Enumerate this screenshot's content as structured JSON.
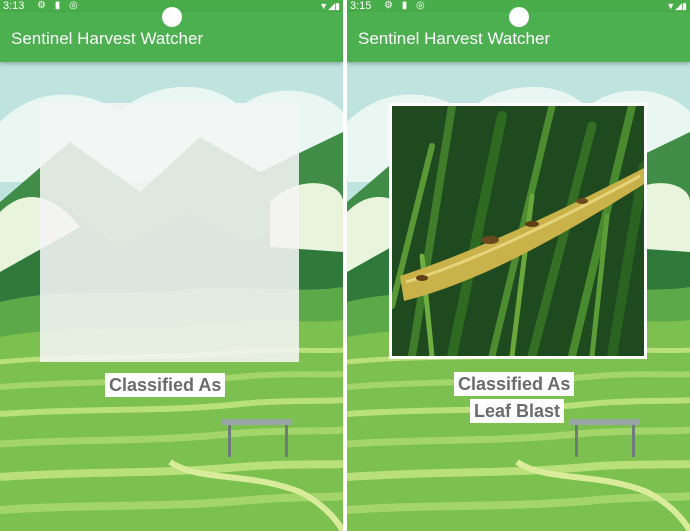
{
  "screens": [
    {
      "status": {
        "time": "3:13",
        "left_icons": "⚙ ▮ ◎",
        "right_icons": "▼◢▮"
      },
      "app_title": "Sentinel Harvest Watcher",
      "image_state": "placeholder",
      "result": {
        "line1": "Classified As",
        "line2": ""
      }
    },
    {
      "status": {
        "time": "3:15",
        "left_icons": "⚙ ▮ ◎",
        "right_icons": "▼◢▮"
      },
      "app_title": "Sentinel Harvest Watcher",
      "image_state": "rice-leaf-photo",
      "result": {
        "line1": "Classified As",
        "line2": "Leaf Blast"
      }
    }
  ],
  "colors": {
    "appbar": "#4caf50",
    "statusbar": "#49ad49",
    "label_text": "#6b6b6b"
  },
  "icons": [
    "settings-icon",
    "sim-card-icon",
    "data-saver-icon",
    "wifi-icon",
    "signal-icon",
    "battery-icon"
  ]
}
